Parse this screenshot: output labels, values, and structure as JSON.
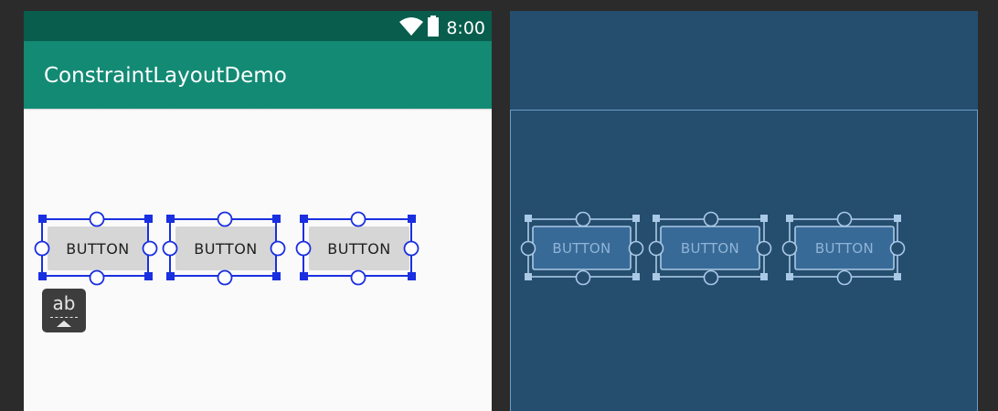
{
  "status_bar": {
    "time": "8:00"
  },
  "app_bar": {
    "title": "ConstraintLayoutDemo"
  },
  "design": {
    "buttons": [
      "BUTTON",
      "BUTTON",
      "BUTTON"
    ],
    "baseline_tool": {
      "label": "ab"
    }
  },
  "blueprint": {
    "buttons": [
      "BUTTON",
      "BUTTON",
      "BUTTON"
    ]
  },
  "colors": {
    "status_bar": "#085d4d",
    "app_bar": "#138a74",
    "selection": "#1a2fe0",
    "blueprint_background": "#254d6e",
    "blueprint_outline": "#a9c9e6"
  },
  "icons": [
    "wifi-icon",
    "battery-icon",
    "baseline-constraint-icon"
  ]
}
